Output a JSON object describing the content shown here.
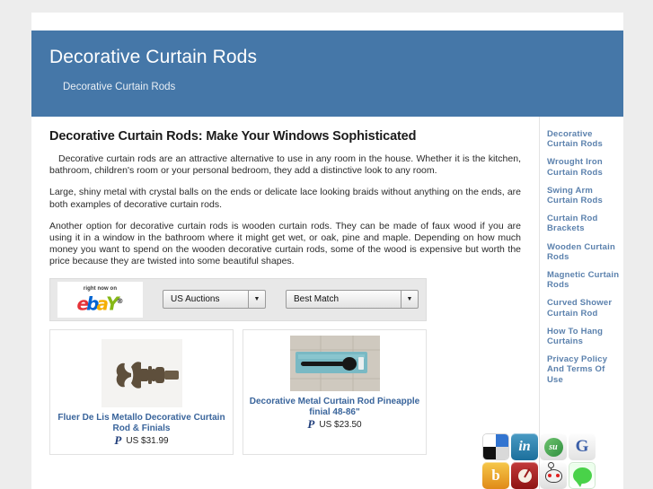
{
  "site": {
    "banner_title": "Decorative Curtain Rods",
    "banner_subtitle": "Decorative Curtain Rods",
    "banner_color": "#4577a8"
  },
  "article": {
    "title": "Decorative Curtain Rods: Make Your Windows Sophisticated",
    "paragraphs": [
      "Decorative curtain rods are an attractive alternative to use in any room in the house. Whether it is the kitchen, bathroom, children's room or your personal bedroom, they add a distinctive look to any room.",
      "Large, shiny metal with crystal balls on the ends or delicate lace looking braids without anything on the ends, are both examples of decorative curtain rods.",
      "Another option for decorative curtain rods is wooden curtain rods. They can be made of faux wood if you are using it in a window in the bathroom where it might get wet, or oak, pine and maple. Depending on how much money you want to spend on the wooden decorative curtain rods, some of the wood is expensive but worth the price because they are twisted into some beautiful shapes."
    ]
  },
  "ebay_widget": {
    "logo_tagline": "right now on",
    "logo_letters": [
      "e",
      "b",
      "a",
      "Y"
    ],
    "logo_trademark": "®",
    "auction_select": {
      "value": "US Auctions",
      "options": [
        "US Auctions"
      ]
    },
    "sort_select": {
      "value": "Best Match",
      "options": [
        "Best Match"
      ]
    },
    "arrow_icon": "▼"
  },
  "products": [
    {
      "title": "Fluer De Lis Metallo Decorative Curtain Rod & Finials",
      "price": "US $31.99",
      "payment_icon": "paypal-icon",
      "payment_glyph": "P",
      "image_alt": "bronze fleur de lis finial curtain rod"
    },
    {
      "title": "Decorative Metal Curtain Rod Pineapple finial 48-86\"",
      "price": "US $23.50",
      "payment_icon": "paypal-icon",
      "payment_glyph": "P",
      "image_alt": "black curtain rod in teal packaging"
    }
  ],
  "sidebar": {
    "links": [
      "Decorative Curtain Rods",
      "Wrought Iron Curtain Rods",
      "Swing Arm Curtain Rods",
      "Curtain Rod Brackets",
      "Wooden Curtain Rods",
      "Magnetic Curtain Rods",
      "Curved Shower Curtain Rod",
      "How To Hang Curtains",
      "Privacy Policy And Terms Of Use"
    ],
    "link_color": "#5b81ad"
  },
  "social": {
    "icons": [
      {
        "name": "delicious-icon",
        "glyph": ""
      },
      {
        "name": "linkedin-icon",
        "glyph": "in"
      },
      {
        "name": "stumbleupon-icon",
        "glyph": "su"
      },
      {
        "name": "google-icon",
        "glyph": "G"
      },
      {
        "name": "bebo-icon",
        "glyph": "b"
      },
      {
        "name": "mixx-icon",
        "glyph": ""
      },
      {
        "name": "reddit-icon",
        "glyph": ""
      },
      {
        "name": "comment-bubble-icon",
        "glyph": ""
      }
    ]
  }
}
